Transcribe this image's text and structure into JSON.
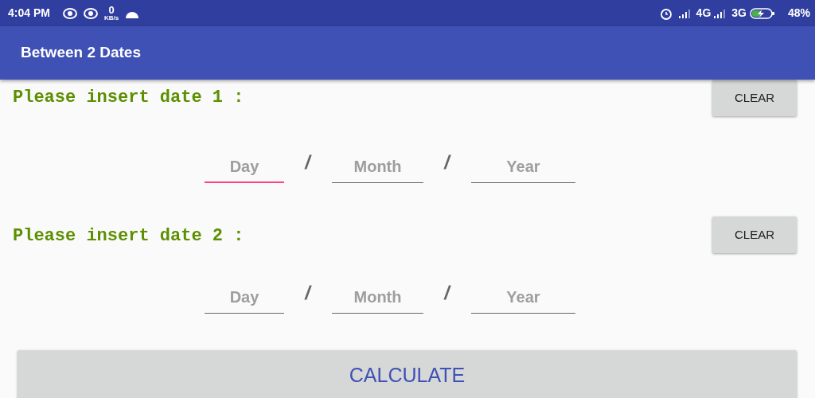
{
  "status_bar": {
    "time": "4:04 PM",
    "speed_value": "0",
    "speed_unit": "KB/s",
    "network_1": "4G",
    "network_2": "3G",
    "battery": "48%"
  },
  "app_bar": {
    "title": "Between 2 Dates"
  },
  "dates": [
    {
      "label": "Please insert date 1 :",
      "clear_button": "CLEAR",
      "separator_1": "/",
      "separator_2": "/",
      "fields": [
        {
          "placeholder": "Day",
          "focused": true
        },
        {
          "placeholder": "Month",
          "focused": false
        },
        {
          "placeholder": "Year",
          "focused": false
        }
      ]
    },
    {
      "label": "Please insert date 2 :",
      "clear_button": "CLEAR",
      "separator_1": "/",
      "separator_2": "/",
      "fields": [
        {
          "placeholder": "Day",
          "focused": false
        },
        {
          "placeholder": "Month",
          "focused": false
        },
        {
          "placeholder": "Year",
          "focused": false
        }
      ]
    }
  ],
  "calculate_button": "CALCULATE"
}
